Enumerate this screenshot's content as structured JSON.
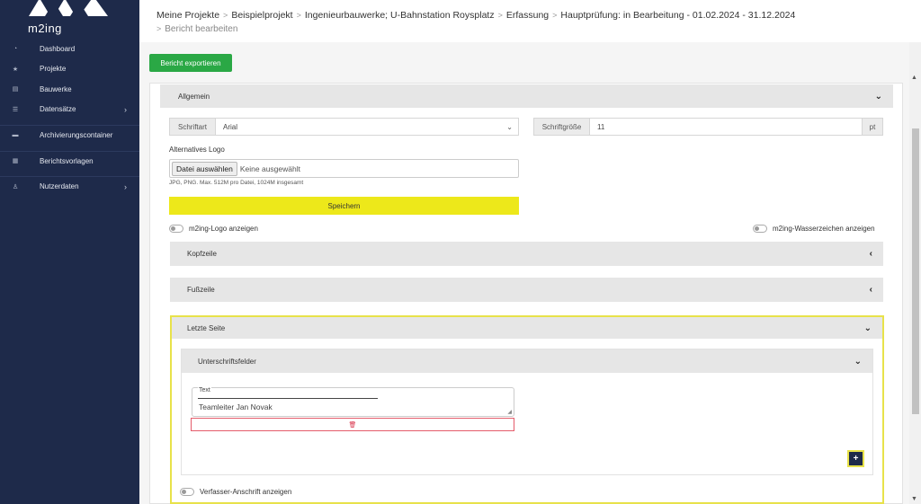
{
  "app": {
    "brand": "m2ing"
  },
  "sidebar": {
    "items": [
      {
        "label": "Dashboard",
        "icon": "dashboard-icon",
        "glyph": "◔",
        "chevron": ""
      },
      {
        "label": "Projekte",
        "icon": "star-icon",
        "glyph": "★",
        "chevron": ""
      },
      {
        "label": "Bauwerke",
        "icon": "building-icon",
        "glyph": "▤",
        "chevron": ""
      },
      {
        "label": "Datensätze",
        "icon": "list-icon",
        "glyph": "☰",
        "chevron": "›"
      },
      {
        "label": "Archivierungscontainer",
        "icon": "archive-icon",
        "glyph": "▬",
        "chevron": ""
      },
      {
        "label": "Berichtsvorlagen",
        "icon": "template-icon",
        "glyph": "▦",
        "chevron": ""
      },
      {
        "label": "Nutzerdaten",
        "icon": "user-icon",
        "glyph": "♙",
        "chevron": "›"
      }
    ]
  },
  "breadcrumb": {
    "items": [
      "Meine Projekte",
      "Beispielprojekt",
      "Ingenieurbauwerke; U-Bahnstation Roysplatz",
      "Erfassung",
      "Hauptprüfung: in Bearbeitung - 01.02.2024 - 31.12.2024"
    ],
    "separator": ">",
    "current": "Bericht bearbeiten"
  },
  "toolbar": {
    "export_label": "Bericht exportieren"
  },
  "allgemein": {
    "title": "Allgemein",
    "font_label": "Schriftart",
    "font_value": "Arial",
    "size_label": "Schriftgröße",
    "size_value": "11",
    "size_unit": "pt",
    "logo_label": "Alternatives Logo",
    "file_button": "Datei auswählen",
    "file_status": "Keine ausgewählt",
    "file_hint": "JPG, PNG. Max. 512M pro Datei, 1024M insgesamt",
    "save_label": "Speichern",
    "toggle_logo": "m2ing-Logo anzeigen",
    "toggle_watermark": "m2ing-Wasserzeichen anzeigen"
  },
  "sections": {
    "kopfzeile": "Kopfzeile",
    "fusszeile": "Fußzeile",
    "letzte_seite": "Letzte Seite",
    "unterschriftsfelder": "Unterschriftsfelder"
  },
  "signature": {
    "legend": "Text",
    "value": "Teamleiter Jan Novak"
  },
  "toggle_author": "Verfasser-Anschrift anzeigen",
  "colors": {
    "sidebar": "#1e2a4a",
    "export": "#2aa845",
    "save": "#ede81a",
    "highlight": "#e8e24a",
    "delete": "#d9334a"
  }
}
